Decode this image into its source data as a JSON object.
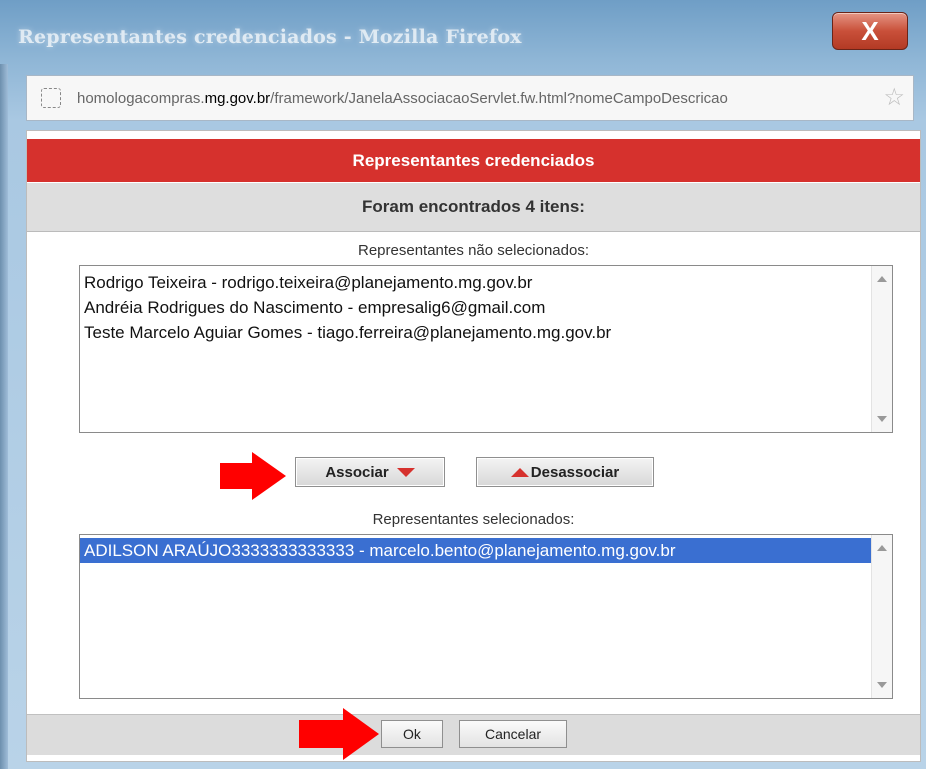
{
  "window": {
    "title": "Representantes credenciados - Mozilla Firefox",
    "close_label": "X"
  },
  "urlbar": {
    "prefix": "homologacompras.",
    "domain": "mg.gov.br",
    "path": "/framework/JanelaAssociacaoServlet.fw.html?nomeCampoDescricao"
  },
  "dialog": {
    "header": "Representantes credenciados",
    "result_count": "Foram encontrados 4 itens:",
    "unselected_label": "Representantes não selecionados:",
    "unselected_items": [
      "Rodrigo Teixeira - rodrigo.teixeira@planejamento.mg.gov.br",
      "Andréia Rodrigues do Nascimento - empresalig6@gmail.com",
      "Teste Marcelo Aguiar Gomes - tiago.ferreira@planejamento.mg.gov.br"
    ],
    "associate_label": "Associar",
    "disassociate_label": "Desassociar",
    "selected_label": "Representantes selecionados:",
    "selected_items": [
      "ADILSON ARAÚJO3333333333333 - marcelo.bento@planejamento.mg.gov.br"
    ],
    "ok_label": "Ok",
    "cancel_label": "Cancelar"
  },
  "colors": {
    "header_red": "#d6312d",
    "selection_blue": "#3a6fd1",
    "annotation_arrow": "#ff0000"
  }
}
